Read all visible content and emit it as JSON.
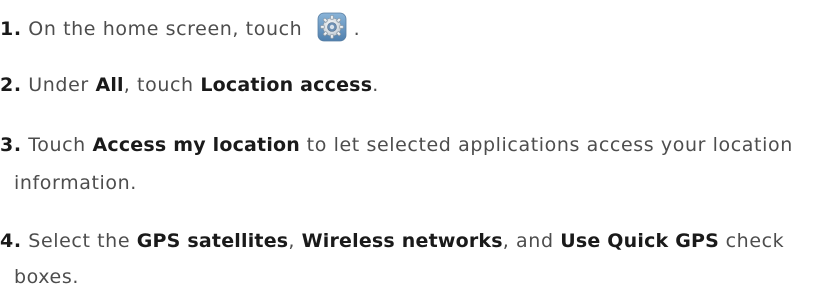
{
  "steps": [
    {
      "number": "1.",
      "text_before": "On the home screen, touch",
      "icon": "settings-gear-icon",
      "text_after": "."
    },
    {
      "number": "2.",
      "t1": "Under ",
      "b1": "All",
      "t2": ", touch ",
      "b2": "Location access",
      "t3": "."
    },
    {
      "number": "3.",
      "t1": "Touch ",
      "b1": "Access my location",
      "t2": " to let selected applications access your location",
      "cont": "information."
    },
    {
      "number": "4.",
      "t1": "Select the ",
      "b1": "GPS satellites",
      "t2": ", ",
      "b2": "Wireless networks",
      "t3": ", and ",
      "b3": "Use Quick GPS",
      "t4": " check",
      "cont": "boxes."
    }
  ]
}
